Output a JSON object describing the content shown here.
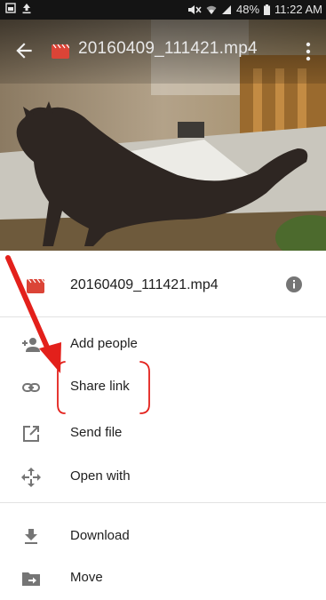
{
  "status_bar": {
    "battery": "48%",
    "time": "11:22 AM"
  },
  "app_bar": {
    "title": "20160409_111421.mp4",
    "back_icon": "arrow-back-icon",
    "overflow_icon": "more-vert-icon"
  },
  "sheet": {
    "file_name": "20160409_111421.mp4",
    "file_icon": "video-file-icon",
    "info_icon": "info-icon",
    "items": [
      {
        "label": "Add people",
        "icon": "person-add-icon"
      },
      {
        "label": "Share link",
        "icon": "link-icon"
      },
      {
        "label": "Send file",
        "icon": "send-file-icon"
      },
      {
        "label": "Open with",
        "icon": "open-with-icon"
      },
      {
        "label": "Download",
        "icon": "download-icon"
      },
      {
        "label": "Move",
        "icon": "move-folder-icon"
      }
    ]
  },
  "colors": {
    "annotation_red": "#e3201b",
    "video_icon_red": "#db4437",
    "icon_gray": "#757575"
  }
}
